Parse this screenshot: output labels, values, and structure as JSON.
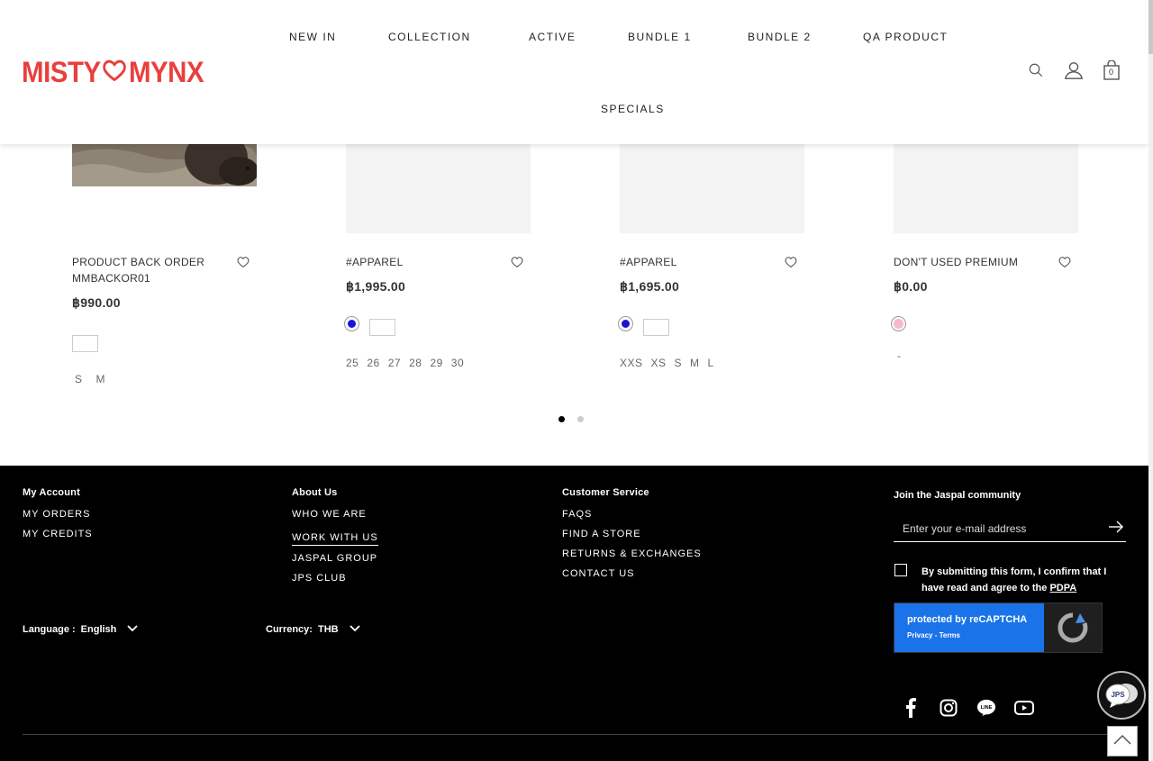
{
  "brand": {
    "logo_left": "MISTY",
    "logo_right": "MYNX",
    "color": "#e8403e"
  },
  "nav": {
    "items": [
      "NEW IN",
      "COLLECTION",
      "ACTIVE",
      "BUNDLE 1",
      "BUNDLE 2",
      "QA PRODUCT",
      "SPECIALS"
    ]
  },
  "header_icons": {
    "search": "search-icon",
    "account": "user-icon",
    "cart": "bag-icon",
    "cart_count": "0"
  },
  "products": [
    {
      "title": "PRODUCT BACK ORDER MMBACKOR01",
      "price": "฿990.00",
      "swatches": [
        "#ffffff"
      ],
      "sizes": [
        "S",
        "M"
      ]
    },
    {
      "title": "#APPAREL",
      "price": "฿1,995.00",
      "swatches": [
        "#1b14d6",
        "#ffffff"
      ],
      "sizes": [
        "25",
        "26",
        "27",
        "28",
        "29",
        "30"
      ]
    },
    {
      "title": "#APPAREL",
      "price": "฿1,695.00",
      "swatches": [
        "#1b14d6",
        "#ffffff"
      ],
      "sizes": [
        "XXS",
        "XS",
        "S",
        "M",
        "L"
      ]
    },
    {
      "title": "DON'T USED PREMIUM",
      "price": "฿0.00",
      "swatches": [
        "#f7b8c9"
      ],
      "sizes": [
        "-"
      ]
    }
  ],
  "carousel": {
    "pages": 2,
    "active": 1
  },
  "footer": {
    "my_account": {
      "heading": "My Account",
      "links": [
        "MY ORDERS",
        "MY CREDITS"
      ]
    },
    "about_us": {
      "heading": "About Us",
      "links": [
        "WHO WE ARE",
        "WORK WITH US",
        "JASPAL GROUP",
        "JPS CLUB"
      ]
    },
    "customer_service": {
      "heading": "Customer Service",
      "links": [
        "FAQS",
        "FIND A STORE",
        "RETURNS & EXCHANGES",
        "CONTACT US"
      ]
    },
    "language": {
      "label": "Language :",
      "value": "English"
    },
    "currency": {
      "label": "Currency:",
      "value": "THB"
    },
    "newsletter": {
      "heading": "Join the Jaspal community",
      "placeholder": "Enter your e-mail address",
      "consent_text": "By submitting this form, I confirm that I have read and agree to the",
      "consent_link": "PDPA"
    },
    "recaptcha": {
      "text": "protected by reCAPTCHA",
      "links": "Privacy - Terms"
    },
    "social": [
      "facebook-icon",
      "instagram-icon",
      "line-icon",
      "youtube-icon"
    ],
    "chat_label": "JPS"
  }
}
